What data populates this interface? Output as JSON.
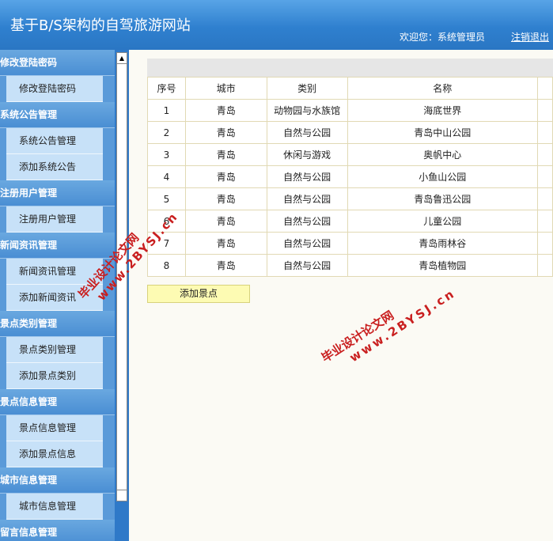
{
  "header": {
    "title": "基于B/S架构的自驾旅游网站",
    "welcome": "欢迎您：系统管理员",
    "logout": "注销退出"
  },
  "sidebar": {
    "sections": [
      {
        "title": "修改登陆密码",
        "items": [
          "修改登陆密码"
        ]
      },
      {
        "title": "系统公告管理",
        "items": [
          "系统公告管理",
          "添加系统公告"
        ]
      },
      {
        "title": "注册用户管理",
        "items": [
          "注册用户管理"
        ]
      },
      {
        "title": "新闻资讯管理",
        "items": [
          "新闻资讯管理",
          "添加新闻资讯"
        ]
      },
      {
        "title": "景点类别管理",
        "items": [
          "景点类别管理",
          "添加景点类别"
        ]
      },
      {
        "title": "景点信息管理",
        "items": [
          "景点信息管理",
          "添加景点信息"
        ]
      },
      {
        "title": "城市信息管理",
        "items": [
          "城市信息管理"
        ]
      },
      {
        "title": "留言信息管理",
        "items": []
      }
    ]
  },
  "table": {
    "headers": [
      "序号",
      "城市",
      "类别",
      "名称"
    ],
    "rows": [
      [
        "1",
        "青岛",
        "动物园与水族馆",
        "海底世界"
      ],
      [
        "2",
        "青岛",
        "自然与公园",
        "青岛中山公园"
      ],
      [
        "3",
        "青岛",
        "休闲与游戏",
        "奥帆中心"
      ],
      [
        "4",
        "青岛",
        "自然与公园",
        "小鱼山公园"
      ],
      [
        "5",
        "青岛",
        "自然与公园",
        "青岛鲁迅公园"
      ],
      [
        "6",
        "青岛",
        "自然与公园",
        "儿童公园"
      ],
      [
        "7",
        "青岛",
        "自然与公园",
        "青岛雨林谷"
      ],
      [
        "8",
        "青岛",
        "自然与公园",
        "青岛植物园"
      ]
    ]
  },
  "add_button": "添加景点",
  "watermark": {
    "line1": "毕业设计论文网",
    "line2": "www.2BYSJ.cn",
    "color": "#c91f1f"
  },
  "colors": {
    "header": "#2f80cf",
    "section": "#4a8ed3",
    "item": "#c7e1f8",
    "button": "#fdfbb3"
  }
}
